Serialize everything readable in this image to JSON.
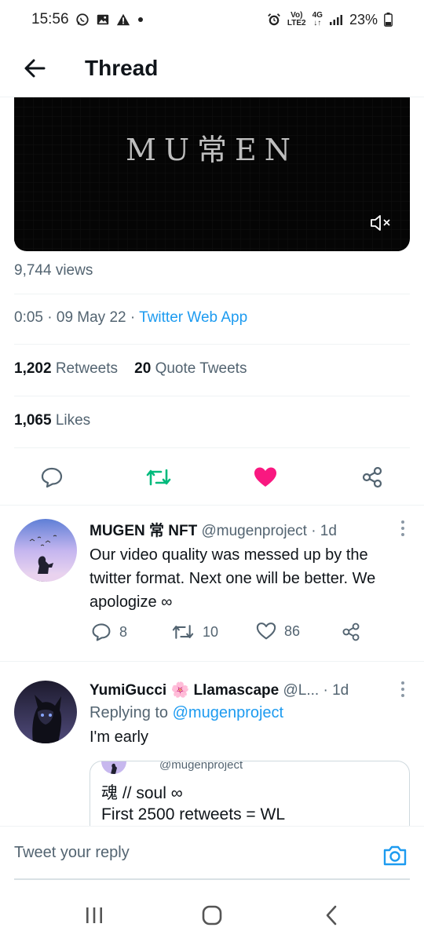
{
  "status_bar": {
    "time": "15:56",
    "notification_icons": [
      "whatsapp-icon",
      "image-icon",
      "warning-icon",
      "dot-icon"
    ],
    "network_label_top": "Vo)",
    "network_label_bottom": "LTE2",
    "network_type": "4G",
    "battery": "23%"
  },
  "header": {
    "title": "Thread"
  },
  "video": {
    "logo_text": "MU常EN"
  },
  "tweet": {
    "views": "9,744 views",
    "time": "0:05",
    "date": "09 May 22",
    "source": "Twitter Web App",
    "retweets_count": "1,202",
    "retweets_label": "Retweets",
    "quotes_count": "20",
    "quotes_label": "Quote Tweets",
    "likes_count": "1,065",
    "likes_label": "Likes",
    "separator": "·"
  },
  "colors": {
    "accent": "#1d9bf0",
    "retweet": "#00ba7c",
    "like": "#f91880",
    "text": "#0f1419",
    "muted": "#536471"
  },
  "replies": [
    {
      "name": "MUGEN 常 NFT",
      "handle": "@mugenproject",
      "time": "· 1d",
      "text": "Our video quality was messed up by the twitter format. Next one will be better. We apologize ∞",
      "reply_count": "8",
      "retweet_count": "10",
      "like_count": "86"
    },
    {
      "name_part1": "YumiGucci",
      "name_emoji": "🌸",
      "name_part2": "Llamascape",
      "handle": "@L...",
      "time": "· 1d",
      "replying_to_label": "Replying to",
      "replying_to_handle": "@mugenproject",
      "text": "I'm early",
      "quote_handle": "@mugenproject",
      "quote_line1": "魂 // soul ∞",
      "quote_line2": "First 2500 retweets = WL"
    }
  ],
  "compose": {
    "placeholder": "Tweet your reply"
  }
}
